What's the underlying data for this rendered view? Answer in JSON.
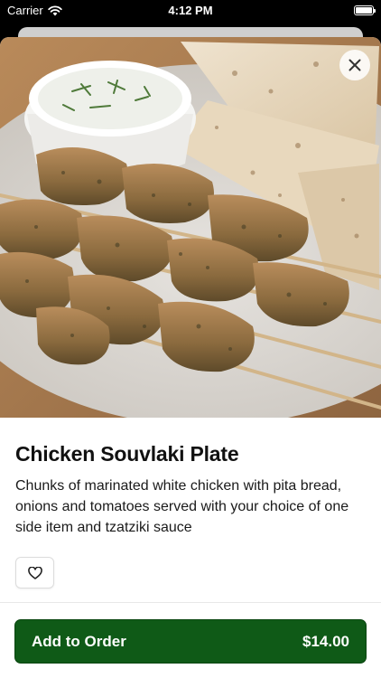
{
  "status_bar": {
    "carrier": "Carrier",
    "time": "4:12 PM",
    "wifi_icon": "wifi-icon",
    "battery_icon": "battery-icon"
  },
  "item": {
    "image_alt": "Chicken souvlaki skewers with pita bread and tzatziki",
    "title": "Chicken Souvlaki Plate",
    "description": "Chunks of marinated white chicken with pita bread, onions and tomatoes served with your choice of one side item and tzatziki sauce"
  },
  "actions": {
    "close_icon": "close-icon",
    "favorite_icon": "heart-icon",
    "order_label": "Add to Order",
    "order_price": "$14.00"
  },
  "colors": {
    "primary": "#0f5a17",
    "text": "#111111",
    "background": "#ffffff"
  }
}
